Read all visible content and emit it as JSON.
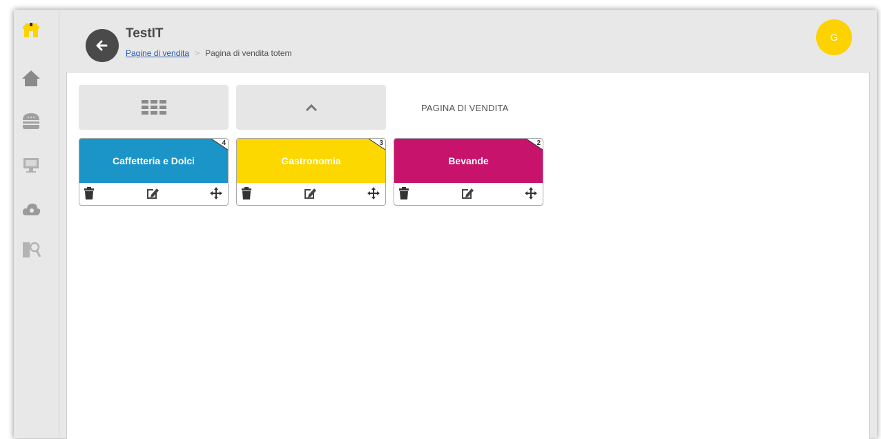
{
  "header": {
    "title": "TestIT",
    "breadcrumb": {
      "link": "Pagine di vendita",
      "current": "Pagina di vendita totem"
    },
    "avatar_initial": "G"
  },
  "sidebar": {
    "items": [
      {
        "icon": "store-icon"
      },
      {
        "icon": "home-icon"
      },
      {
        "icon": "burger-icon"
      },
      {
        "icon": "monitor-icon"
      },
      {
        "icon": "cloud-icon"
      },
      {
        "icon": "search-user-icon"
      }
    ]
  },
  "toolbar": {
    "grid_button_icon": "grid-icon",
    "up_button_icon": "chevron-up-icon",
    "page_label": "PAGINA DI VENDITA"
  },
  "tiles": [
    {
      "label": "Caffetteria e Dolci",
      "count": "4",
      "color": "#1b95c8"
    },
    {
      "label": "Gastronomia",
      "count": "3",
      "color": "#fcd700"
    },
    {
      "label": "Bevande",
      "count": "2",
      "color": "#c7136b"
    }
  ],
  "colors": {
    "accent": "#fcd200",
    "sidebar_bg": "#e8e8e8"
  }
}
